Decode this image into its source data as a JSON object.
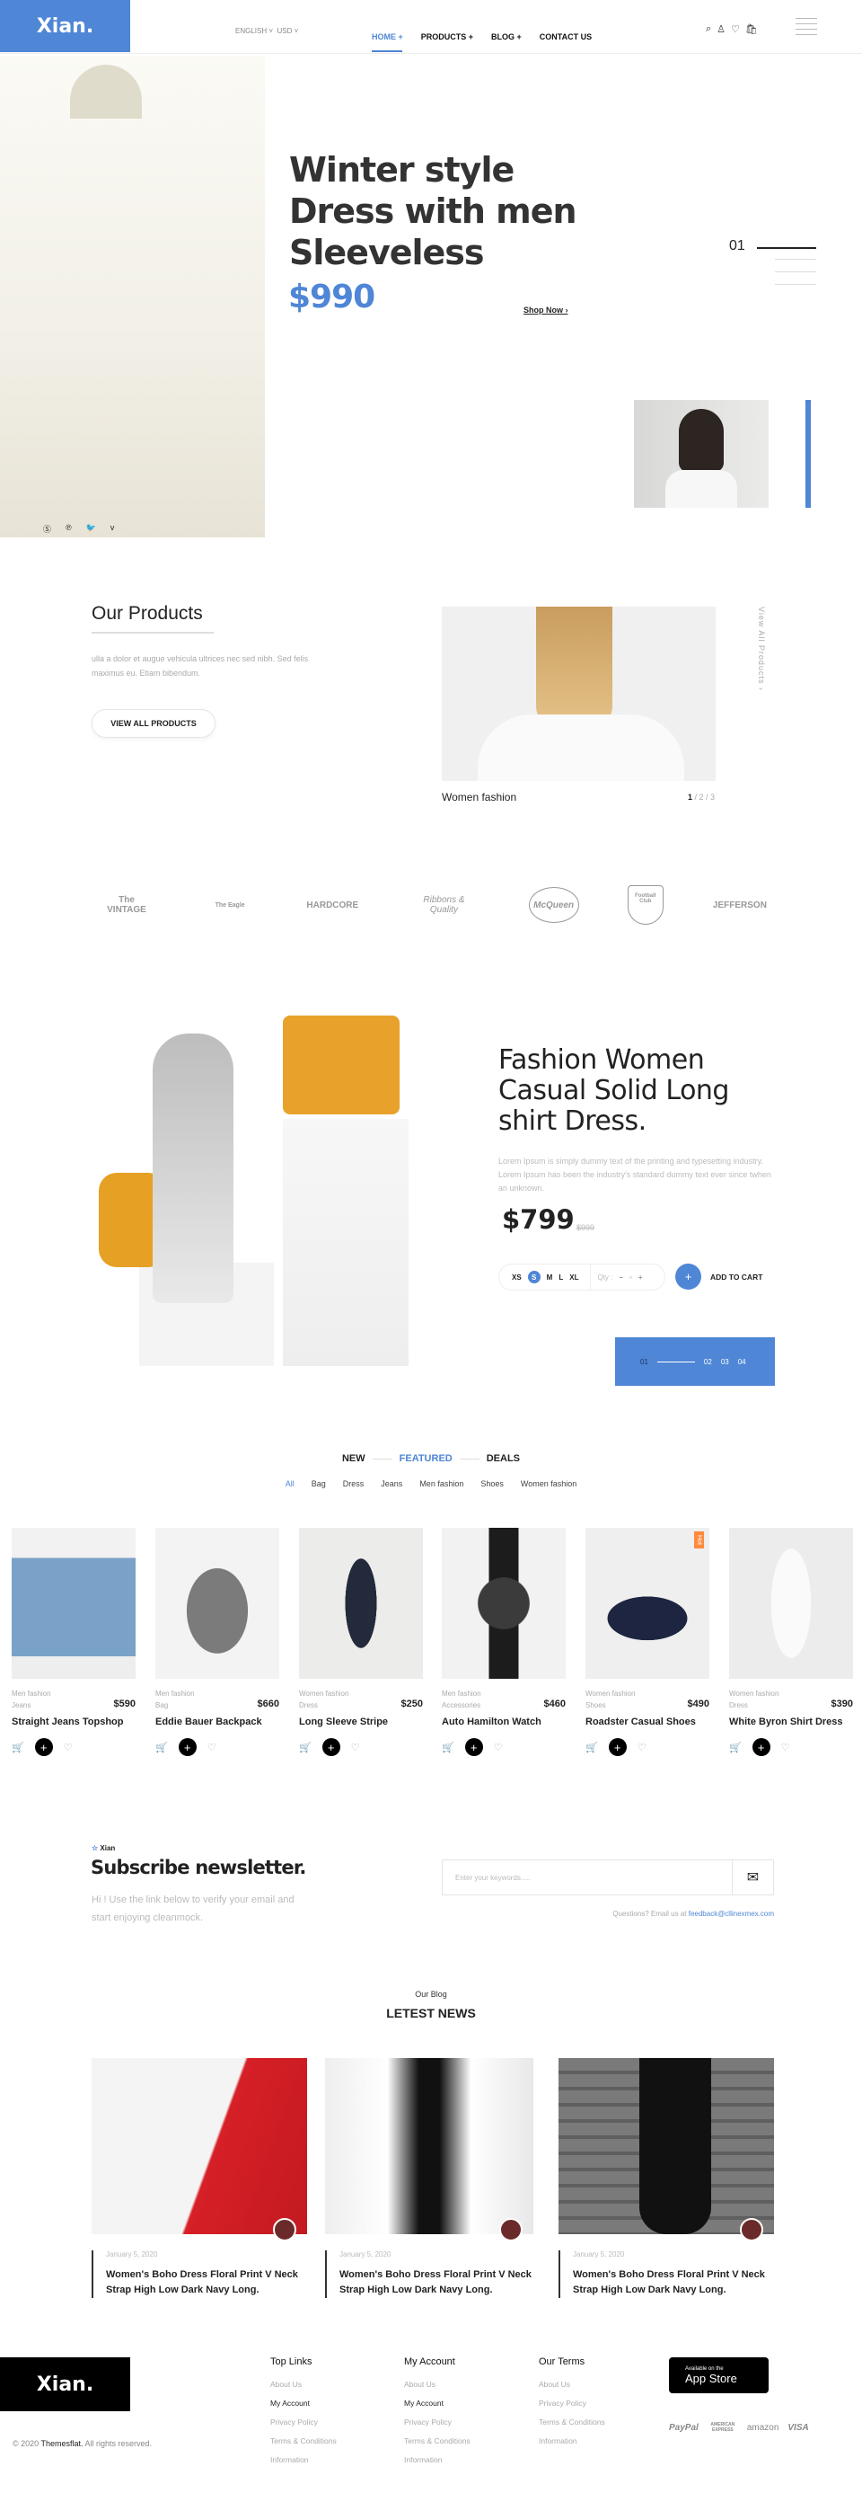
{
  "colors": {
    "accent": "#4f86d6",
    "hot": "#ff8a3d"
  },
  "header": {
    "logo": "Xian.",
    "language": "ENGLISH",
    "currency": "USD",
    "nav": [
      "HOME +",
      "PRODUCTS +",
      "BLOG +",
      "CONTACT US"
    ],
    "icons": [
      "search-icon",
      "user-icon",
      "heart-icon",
      "bag-icon",
      "menu-icon"
    ]
  },
  "hero": {
    "title_lines": [
      "Winter style",
      "Dress with men",
      "Sleeveless"
    ],
    "price": "$990",
    "cta": "Shop Now ›",
    "slide": "01",
    "social": [
      "skype-icon",
      "pinterest-icon",
      "twitter-icon",
      "vimeo-icon"
    ]
  },
  "our_products": {
    "title": "Our Products",
    "text": "ulla a dolor et augue vehicula ultrices nec sed nibh. Sed felis maximus eu. Etiam bibendum.",
    "button": "VIEW ALL PRODUCTS",
    "caption": "Women fashion",
    "pager_current": "1",
    "pager_rest": " / 2 / 3",
    "view_all": "View All Products ›"
  },
  "brands": [
    "The VINTAGE",
    "The Eagle",
    "HARDCORE",
    "Ribbons & Quality",
    "McQueen",
    "Football Club",
    "JEFFERSON"
  ],
  "feature": {
    "title": "Fashion Women Casual Solid Long shirt Dress.",
    "desc": "Lorem Ipsum is simply dummy text of the printing and typesetting industry. Lorem Ipsum has been the industry's standard dummy text ever since twhen an unknown.",
    "price": "$799",
    "old_price": "$999",
    "sizes": [
      "XS",
      "S",
      "M",
      "L",
      "XL"
    ],
    "selected_size": "S",
    "qty_label": "Qty :",
    "add_to_cart": "ADD TO CART",
    "slides": [
      "01",
      "02",
      "03",
      "04"
    ]
  },
  "tabs": {
    "items": [
      "NEW",
      "FEATURED",
      "DEALS"
    ],
    "active": "FEATURED",
    "filters": [
      "All",
      "Bag",
      "Dress",
      "Jeans",
      "Men fashion",
      "Shoes",
      "Women fashion"
    ]
  },
  "products": [
    {
      "group": "Men fashion",
      "type": "Jeans",
      "price": "$590",
      "name": "Straight Jeans Topshop"
    },
    {
      "group": "Men fashion",
      "type": "Bag",
      "price": "$660",
      "name": "Eddie Bauer Backpack"
    },
    {
      "group": "Women fashion",
      "type": "Dress",
      "price": "$250",
      "name": "Long Sleeve Stripe"
    },
    {
      "group": "Men fashion",
      "type": "Accessories",
      "price": "$460",
      "name": "Auto Hamilton Watch"
    },
    {
      "group": "Women fashion",
      "type": "Shoes",
      "price": "$490",
      "name": "Roadster Casual Shoes",
      "badge": "Hot"
    },
    {
      "group": "Women fashion",
      "type": "Dress",
      "price": "$390",
      "name": "White Byron Shirt Dress"
    }
  ],
  "newsletter": {
    "brand": "Xian",
    "title": "Subscribe newsletter.",
    "text": "Hi ! Use the link below to verify your email and start enjoying cleanmock.",
    "placeholder": "Enter your keywords.....",
    "questions": "Questions? Email us at ",
    "email": "feedback@cllinexmex.com"
  },
  "blog": {
    "kicker": "Our Blog",
    "title": "LETEST NEWS",
    "posts": [
      {
        "date": "January 5, 2020",
        "title": "Women's Boho Dress Floral Print V Neck Strap High Low Dark Navy Long."
      },
      {
        "date": "January 5, 2020",
        "title": "Women's Boho Dress Floral Print V Neck Strap High Low Dark Navy Long."
      },
      {
        "date": "January 5, 2020",
        "title": "Women's Boho Dress Floral Print V Neck Strap High Low Dark Navy Long."
      }
    ]
  },
  "footer": {
    "logo": "Xian.",
    "copyright_pre": "© 2020 ",
    "copyright_brand": "Themesflat.",
    "copyright_post": " All rights reserved.",
    "columns": [
      {
        "title": "Top Links",
        "links": [
          "About Us",
          "My Account",
          "Privacy Policy",
          "Terms & Conditions",
          "Information"
        ]
      },
      {
        "title": "My Account",
        "links": [
          "About Us",
          "My Account",
          "Privacy Policy",
          "Terms & Conditions",
          "Information"
        ]
      },
      {
        "title": "Our Terms",
        "links": [
          "About Us",
          "Privacy Policy",
          "Terms & Conditions",
          "Information"
        ]
      }
    ],
    "appstore_small": "Available on the",
    "appstore_big": "App Store",
    "payments": [
      "PayPal",
      "AMERICAN EXPRESS",
      "amazon",
      "VISA"
    ]
  }
}
